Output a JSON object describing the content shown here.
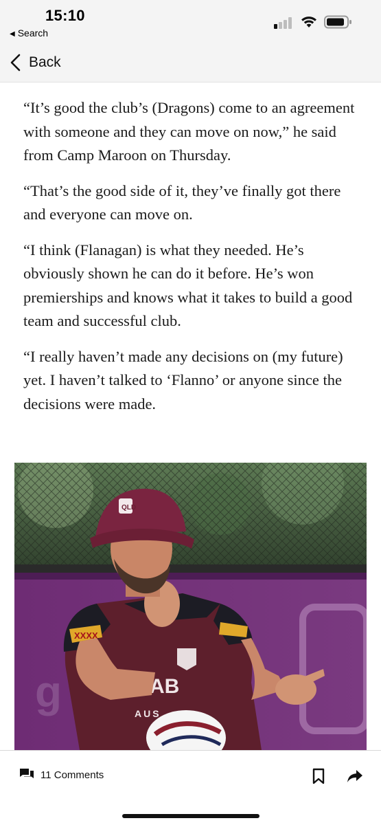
{
  "status_bar": {
    "time": "15:10",
    "back_to_app": "Search",
    "icons": [
      "cellular-signal-icon",
      "wifi-icon",
      "battery-icon"
    ]
  },
  "nav": {
    "back_label": "Back",
    "back_icon": "chevron-left-icon"
  },
  "article": {
    "paragraphs": [
      "“It’s good the club’s (Dragons) come to an agreement with someone and they can move on now,” he said from Camp Maroon on Thursday.",
      "“That’s the good side of it, they’ve finally got there and everyone can move on.",
      "“I think (Flanagan) is what they needed. He’s obviously shown he can do it before. He’s won premierships and knows what it takes to build a good team and successful club.",
      "“I really haven’t made any decisions on (my future) yet. I haven’t talked to ‘Flanno’ or anyone since the decisions were made."
    ]
  },
  "photo": {
    "description_icon": "article-photo",
    "jersey_text": "AUS",
    "hat_badge": "QLD"
  },
  "bottom_bar": {
    "comments_label": "11 Comments",
    "comments_icon": "chat-bubbles-icon",
    "bookmark_icon": "bookmark-icon",
    "share_icon": "share-arrow-icon"
  },
  "colors": {
    "chrome_background": "#f4f4f4",
    "text": "#1a1a1a",
    "maroon": "#6b1f35"
  }
}
